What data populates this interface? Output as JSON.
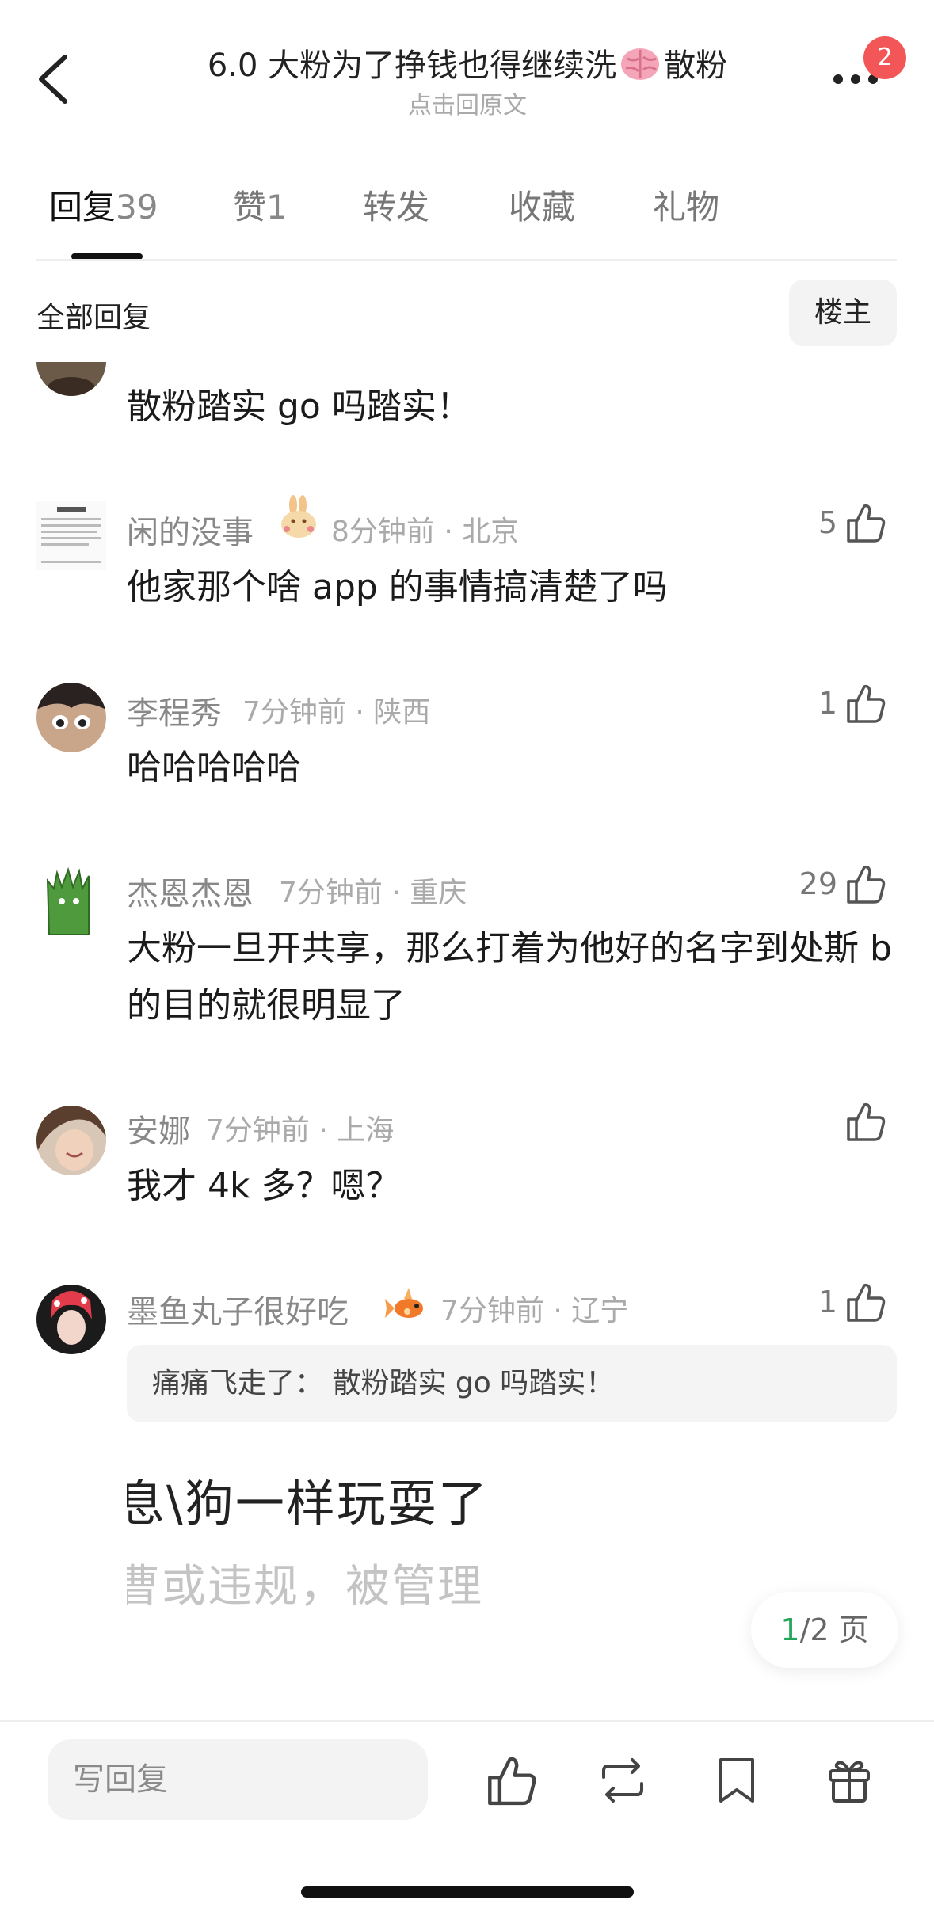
{
  "header": {
    "title_part1": "6.0 大粉为了挣钱也得继续洗",
    "title_part2": "散粉",
    "subtitle": "点击回原文",
    "notification_count": "2"
  },
  "tabs": [
    {
      "label": "回复",
      "count": "39",
      "active": true
    },
    {
      "label": "赞",
      "count": "1",
      "active": false
    },
    {
      "label": "转发",
      "count": "",
      "active": false
    },
    {
      "label": "收藏",
      "count": "",
      "active": false
    },
    {
      "label": "礼物",
      "count": "",
      "active": false
    }
  ],
  "filter": {
    "label": "全部回复",
    "owner_button": "楼主"
  },
  "comments": [
    {
      "name": "",
      "meta": "",
      "text": "散粉踏实 go 吗踏实！",
      "likes": ""
    },
    {
      "name": "闲的没事",
      "meta": "8分钟前 · 北京",
      "text": "他家那个啥 app 的事情搞清楚了吗",
      "likes": "5"
    },
    {
      "name": "李程秀",
      "meta": "7分钟前 · 陕西",
      "text": "哈哈哈哈哈",
      "likes": "1"
    },
    {
      "name": "杰恩杰恩",
      "meta": "7分钟前 · 重庆",
      "text": "大粉一旦开共享，那么打着为他好的名字到处斯 b 的目的就很明显了",
      "likes": "29"
    },
    {
      "name": "安娜",
      "meta": "7分钟前 · 上海",
      "text": "我才 4k 多？嗯？",
      "likes": ""
    },
    {
      "name": "墨鱼丸子很好吃",
      "meta": "7分钟前 · 辽宁",
      "text": "",
      "likes": "1",
      "quote": "痛痛飞走了：  散粉踏实 go 吗踏实！",
      "image_text_line1": "息\\狗一样玩耍了",
      "image_text_line2": "曹或违规，被管理"
    }
  ],
  "pagination": {
    "current": "1",
    "rest": "/2 页"
  },
  "bottom_bar": {
    "reply_placeholder": "写回复"
  },
  "colors": {
    "accent_green": "#22a558",
    "badge_red": "#f25656",
    "text_gray": "#888888"
  }
}
